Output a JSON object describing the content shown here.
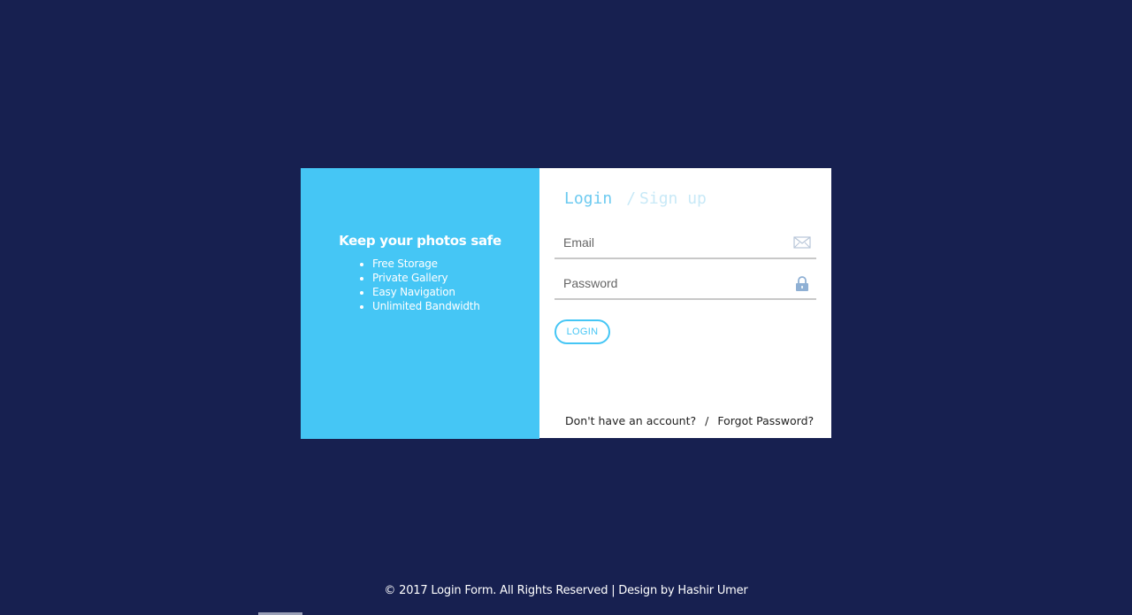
{
  "promo": {
    "title": "Keep your photos safe",
    "features": [
      "Free Storage",
      "Private Gallery",
      "Easy Navigation",
      "Unlimited Bandwidth"
    ]
  },
  "tabs": {
    "login": "Login",
    "separator": "/",
    "signup": "Sign up"
  },
  "form": {
    "email_placeholder": "Email",
    "password_placeholder": "Password",
    "login_button": "LOGIN"
  },
  "links": {
    "no_account": "Don't have an account?",
    "separator": "/",
    "forgot_password": "Forgot Password?"
  },
  "footer": {
    "text": "© 2017 Login Form. All Rights Reserved | Design by Hashir Umer"
  },
  "colors": {
    "background": "#172050",
    "accent": "#45c6f5",
    "panel": "#ffffff"
  },
  "icons": {
    "email": "envelope-icon",
    "password": "lock-icon"
  }
}
